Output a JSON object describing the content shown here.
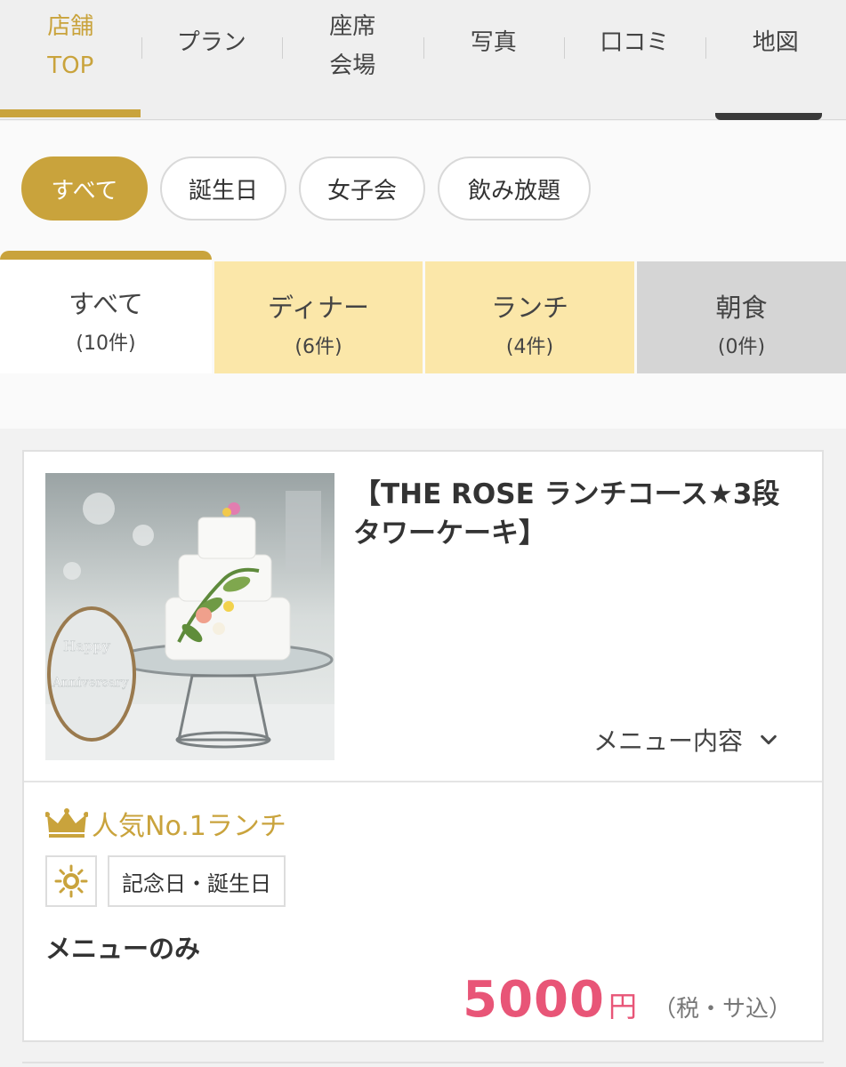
{
  "nav": {
    "tabs": [
      {
        "label": "店舗\nTOP",
        "active": true
      },
      {
        "label": "プラン",
        "active": false
      },
      {
        "label": "座席\n会場",
        "active": false
      },
      {
        "label": "写真",
        "active": false
      },
      {
        "label": "口コミ",
        "active": false
      },
      {
        "label": "地図",
        "active": false
      }
    ]
  },
  "filters": {
    "chips": [
      {
        "label": "すべて",
        "active": true
      },
      {
        "label": "誕生日",
        "active": false
      },
      {
        "label": "女子会",
        "active": false
      },
      {
        "label": "飲み放題",
        "active": false
      }
    ]
  },
  "meal_tabs": [
    {
      "name": "すべて",
      "count": "(10件)",
      "state": "active"
    },
    {
      "name": "ディナー",
      "count": "(6件)",
      "state": "yellow"
    },
    {
      "name": "ランチ",
      "count": "(4件)",
      "state": "yellow"
    },
    {
      "name": "朝食",
      "count": "(0件)",
      "state": "gray"
    }
  ],
  "plan": {
    "title": "【THE ROSE ランチコース★3段タワーケーキ】",
    "menu_link": "メニュー内容",
    "rank": "人気No.1ランチ",
    "tag": "記念日・誕生日",
    "type": "メニューのみ",
    "price": "5000",
    "currency": "円",
    "tax_note": "（税・サ込）",
    "photo_text": [
      "Happy",
      "Anniversary"
    ]
  },
  "colors": {
    "accent": "#c9a33c",
    "price": "#e85577",
    "tab_yellow": "#fbe7a9",
    "tab_gray": "#d5d5d5"
  }
}
